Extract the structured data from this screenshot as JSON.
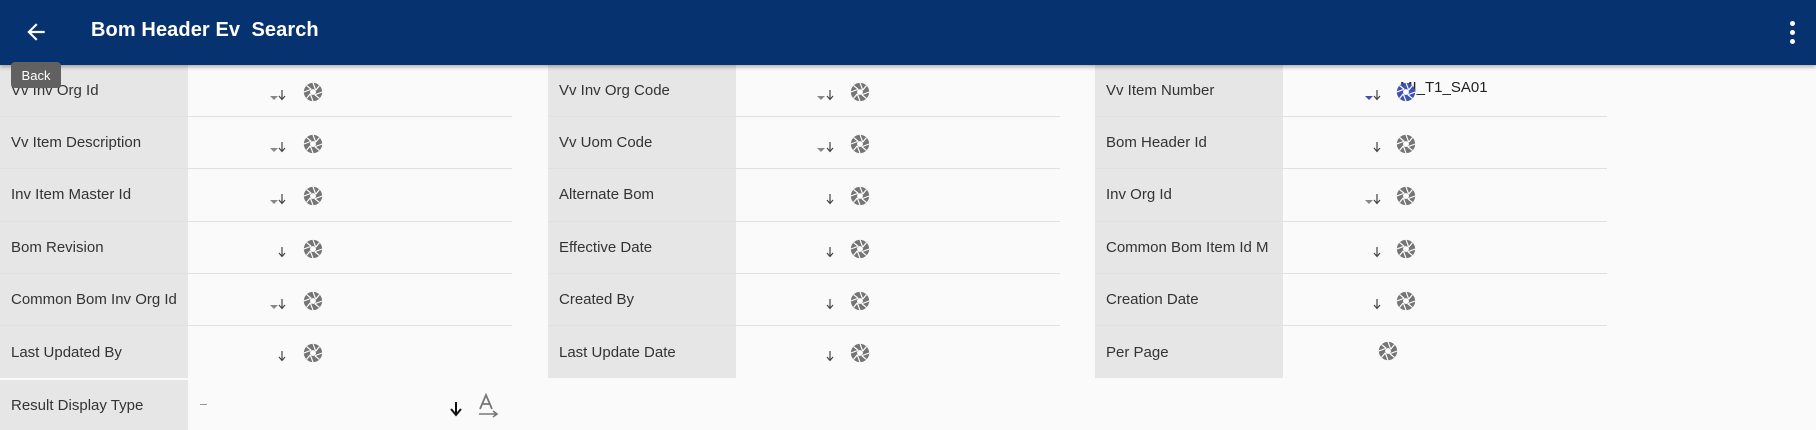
{
  "header": {
    "title": "Bom Header Ev  Search",
    "back_tooltip": "Back"
  },
  "columns": [
    {
      "fields": [
        {
          "label": "Vv Inv Org Id",
          "value": "",
          "has_dropdown": true
        },
        {
          "label": "Vv Item Description",
          "value": "",
          "has_dropdown": true
        },
        {
          "label": "Inv Item Master Id",
          "value": "",
          "has_dropdown": true
        },
        {
          "label": "Bom Revision",
          "value": "",
          "has_dropdown": false
        },
        {
          "label": "Common Bom Inv Org Id",
          "value": "",
          "has_dropdown": true
        },
        {
          "label": "Last Updated By",
          "value": "",
          "has_dropdown": false
        }
      ]
    },
    {
      "fields": [
        {
          "label": "Vv Inv Org Code",
          "value": "",
          "has_dropdown": true
        },
        {
          "label": "Vv Uom Code",
          "value": "",
          "has_dropdown": true
        },
        {
          "label": "Alternate Bom",
          "value": "",
          "has_dropdown": false
        },
        {
          "label": "Effective Date",
          "value": "",
          "has_dropdown": false
        },
        {
          "label": "Created By",
          "value": "",
          "has_dropdown": false
        },
        {
          "label": "Last Update Date",
          "value": "",
          "has_dropdown": false
        }
      ]
    },
    {
      "fields": [
        {
          "label": "Vv Item Number",
          "value": "MI_T1_SA01",
          "has_dropdown": true,
          "active": true
        },
        {
          "label": "Bom Header Id",
          "value": "",
          "has_dropdown": false
        },
        {
          "label": "Inv Org Id",
          "value": "",
          "has_dropdown": true
        },
        {
          "label": "Common Bom Item Id M",
          "value": "",
          "has_dropdown": false
        },
        {
          "label": "Creation Date",
          "value": "",
          "has_dropdown": false
        },
        {
          "label": "Per Page",
          "value": "",
          "has_dropdown": false,
          "no_sort": true
        }
      ]
    }
  ],
  "result_display": {
    "label": "Result Display Type",
    "value": ""
  },
  "colors": {
    "appbar": "#063370",
    "active_icon": "#3f51b5",
    "icon": "#757575"
  },
  "icons": {
    "back": "arrow-left-icon",
    "menu": "more-vert-icon",
    "sort": "arrow-down-icon",
    "camera": "camera-shutter-icon",
    "text_direction": "text-direction-icon"
  }
}
